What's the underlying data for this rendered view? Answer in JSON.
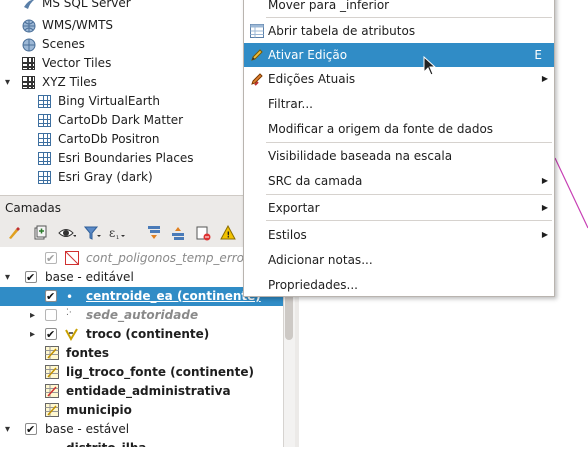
{
  "browser": {
    "items": [
      {
        "label": "MS SQL Server",
        "icon": "mssql-icon"
      },
      {
        "label": "WMS/WMTS",
        "icon": "wms-globe-icon"
      },
      {
        "label": "Scenes",
        "icon": "scenes-globe-icon"
      },
      {
        "label": "Vector Tiles",
        "icon": "vector-tiles-icon"
      },
      {
        "label": "XYZ Tiles",
        "icon": "xyz-tiles-icon"
      },
      {
        "label": "Bing VirtualEarth",
        "icon": "tile-icon"
      },
      {
        "label": "CartoDb Dark Matter",
        "icon": "tile-icon"
      },
      {
        "label": "CartoDb Positron",
        "icon": "tile-icon"
      },
      {
        "label": "Esri Boundaries Places",
        "icon": "tile-icon"
      },
      {
        "label": "Esri Gray (dark)",
        "icon": "tile-icon"
      }
    ]
  },
  "layers_panel": {
    "title": "Camadas",
    "rows": [
      {
        "label": "cont_poligonos_temp_erros",
        "style": "italic"
      },
      {
        "label": "base - editável",
        "style": "group"
      },
      {
        "label": "centroide_ea (continente)",
        "style": "selected"
      },
      {
        "label": "sede_autoridade",
        "style": "italic"
      },
      {
        "label": "troco (continente)",
        "style": "bold"
      },
      {
        "label": "fontes",
        "style": "bold"
      },
      {
        "label": "lig_troco_fonte (continente)",
        "style": "bold"
      },
      {
        "label": "entidade_administrativa",
        "style": "bold"
      },
      {
        "label": "municipio",
        "style": "bold"
      },
      {
        "label": "base - estável",
        "style": "group"
      },
      {
        "label": "distrito_ilha",
        "style": "bold"
      }
    ]
  },
  "context_menu": {
    "items": [
      {
        "label": "Mover para _inferior"
      },
      {
        "label": "Abrir tabela de atributos"
      },
      {
        "label": "Ativar Edição",
        "shortcut": "E",
        "highlighted": true
      },
      {
        "label": "Edições Atuais",
        "submenu": true
      },
      {
        "label": "Filtrar..."
      },
      {
        "label": "Modificar a origem da fonte de dados"
      },
      {
        "label": "Visibilidade baseada na escala"
      },
      {
        "label": "SRC da camada",
        "submenu": true
      },
      {
        "label": "Exportar",
        "submenu": true
      },
      {
        "label": "Estilos",
        "submenu": true
      },
      {
        "label": "Adicionar notas..."
      },
      {
        "label": "Propriedades..."
      }
    ]
  },
  "colors": {
    "highlight": "#308cc6",
    "canvas_line": "#c73fb4"
  }
}
